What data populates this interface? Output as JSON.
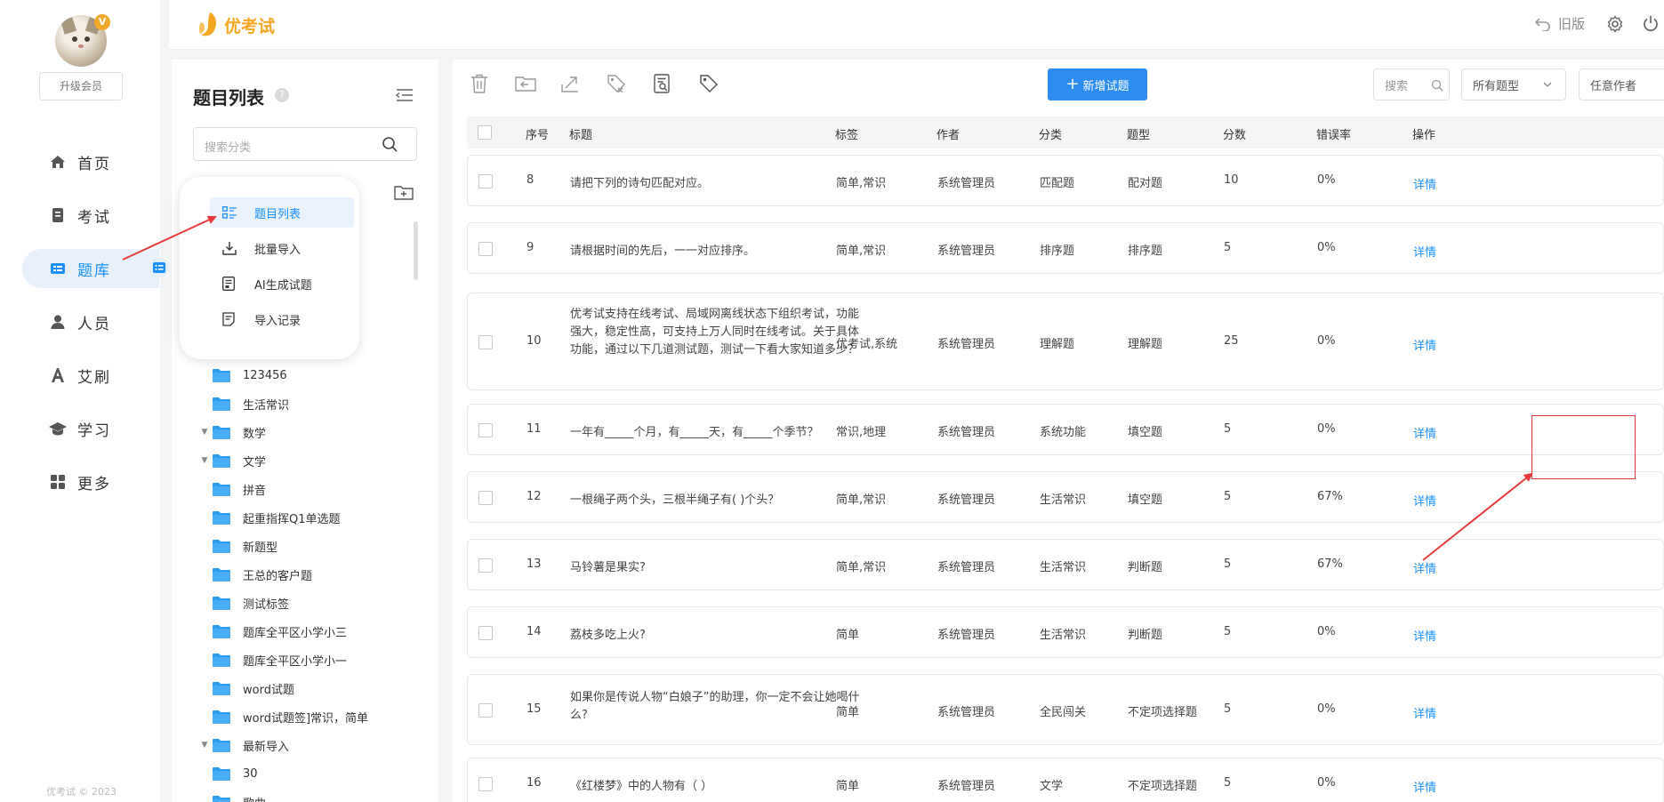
{
  "app": {
    "name": "优考试",
    "copyright": "优考试 © 2023"
  },
  "user": {
    "vip_badge": "V",
    "upgrade_label": "升级会员"
  },
  "nav": {
    "items": [
      {
        "label": "首页",
        "icon": "home-icon"
      },
      {
        "label": "考试",
        "icon": "exam-icon"
      },
      {
        "label": "题库",
        "icon": "question-bank-icon"
      },
      {
        "label": "人员",
        "icon": "user-icon"
      },
      {
        "label": "艾刷",
        "icon": "brush-icon"
      },
      {
        "label": "学习",
        "icon": "graduation-cap-icon"
      },
      {
        "label": "更多",
        "icon": "grid-more-icon"
      }
    ],
    "active": 2
  },
  "header": {
    "old_version": "旧版"
  },
  "category": {
    "title": "题目列表",
    "help": "?",
    "search_placeholder": "搜索分类",
    "folders": [
      {
        "name": "123456",
        "caret": ""
      },
      {
        "name": "生活常识",
        "caret": ""
      },
      {
        "name": "数学",
        "caret": "▼"
      },
      {
        "name": "文学",
        "caret": "▼"
      },
      {
        "name": "拼音",
        "caret": ""
      },
      {
        "name": "起重指挥Q1单选题",
        "caret": ""
      },
      {
        "name": "新题型",
        "caret": ""
      },
      {
        "name": "王总的客户题",
        "caret": ""
      },
      {
        "name": "测试标签",
        "caret": ""
      },
      {
        "name": "题库全平区小学小三",
        "caret": ""
      },
      {
        "name": "题库全平区小学小一",
        "caret": ""
      },
      {
        "name": "word试题",
        "caret": ""
      },
      {
        "name": "word试题签]常识，简单",
        "caret": ""
      },
      {
        "name": "最新导入",
        "caret": "▼"
      },
      {
        "name": "30",
        "caret": ""
      },
      {
        "name": "歌曲",
        "caret": ""
      }
    ]
  },
  "popup": {
    "items": [
      "题目列表",
      "批量导入",
      "AI生成试题",
      "导入记录"
    ]
  },
  "toolbar": {
    "add_label": "新增试题",
    "search_label": "搜索",
    "type_filter": "所有题型",
    "author_filter": "任意作者"
  },
  "table": {
    "headers": [
      "序号",
      "标题",
      "标签",
      "作者",
      "分类",
      "题型",
      "分数",
      "错误率",
      "操作"
    ],
    "rows": [
      {
        "no": "8",
        "title": "请把下列的诗句匹配对应。",
        "tags": "简单,常识",
        "author": "系统管理员",
        "category": "匹配题",
        "type": "配对题",
        "score": "10",
        "error": "0%",
        "action": "详情"
      },
      {
        "no": "9",
        "title": "请根据时间的先后，一一对应排序。",
        "tags": "简单,常识",
        "author": "系统管理员",
        "category": "排序题",
        "type": "排序题",
        "score": "5",
        "error": "0%",
        "action": "详情"
      },
      {
        "no": "10",
        "title": "优考试支持在线考试、局域网离线状态下组织考试，功能强大，稳定性高，可支持上万人同时在线考试。关于具体功能，通过以下几道测试题，测试一下看大家知道多少？",
        "tags": "优考试,系统",
        "author": "系统管理员",
        "category": "理解题",
        "type": "理解题",
        "score": "25",
        "error": "0%",
        "action": "详情"
      },
      {
        "no": "11",
        "title": "一年有_____个月，有_____天，有_____个季节？",
        "tags": "常识,地理",
        "author": "系统管理员",
        "category": "系统功能",
        "type": "填空题",
        "score": "5",
        "error": "0%",
        "action": "详情"
      },
      {
        "no": "12",
        "title": "一根绳子两个头，三根半绳子有(      )个头？",
        "tags": "简单,常识",
        "author": "系统管理员",
        "category": "生活常识",
        "type": "填空题",
        "score": "5",
        "error": "67%",
        "action": "详情"
      },
      {
        "no": "13",
        "title": "马铃薯是果实?",
        "tags": "简单,常识",
        "author": "系统管理员",
        "category": "生活常识",
        "type": "判断题",
        "score": "5",
        "error": "67%",
        "action": "详情"
      },
      {
        "no": "14",
        "title": "荔枝多吃上火?",
        "tags": "简单",
        "author": "系统管理员",
        "category": "生活常识",
        "type": "判断题",
        "score": "5",
        "error": "0%",
        "action": "详情"
      },
      {
        "no": "15",
        "title": "如果你是传说人物“白娘子”的助理，你一定不会让她喝什么?",
        "tags": "简单",
        "author": "系统管理员",
        "category": "全民闯关",
        "type": "不定项选择题",
        "score": "5",
        "error": "0%",
        "action": "详情"
      },
      {
        "no": "16",
        "title": "《红楼梦》中的人物有（  ）",
        "tags": "简单",
        "author": "系统管理员",
        "category": "文学",
        "type": "不定项选择题",
        "score": "5",
        "error": "0%",
        "action": "详情"
      }
    ]
  },
  "colors": {
    "accent": "#1890ff",
    "brand": "#f5a623",
    "annotation": "#e63a3a"
  }
}
